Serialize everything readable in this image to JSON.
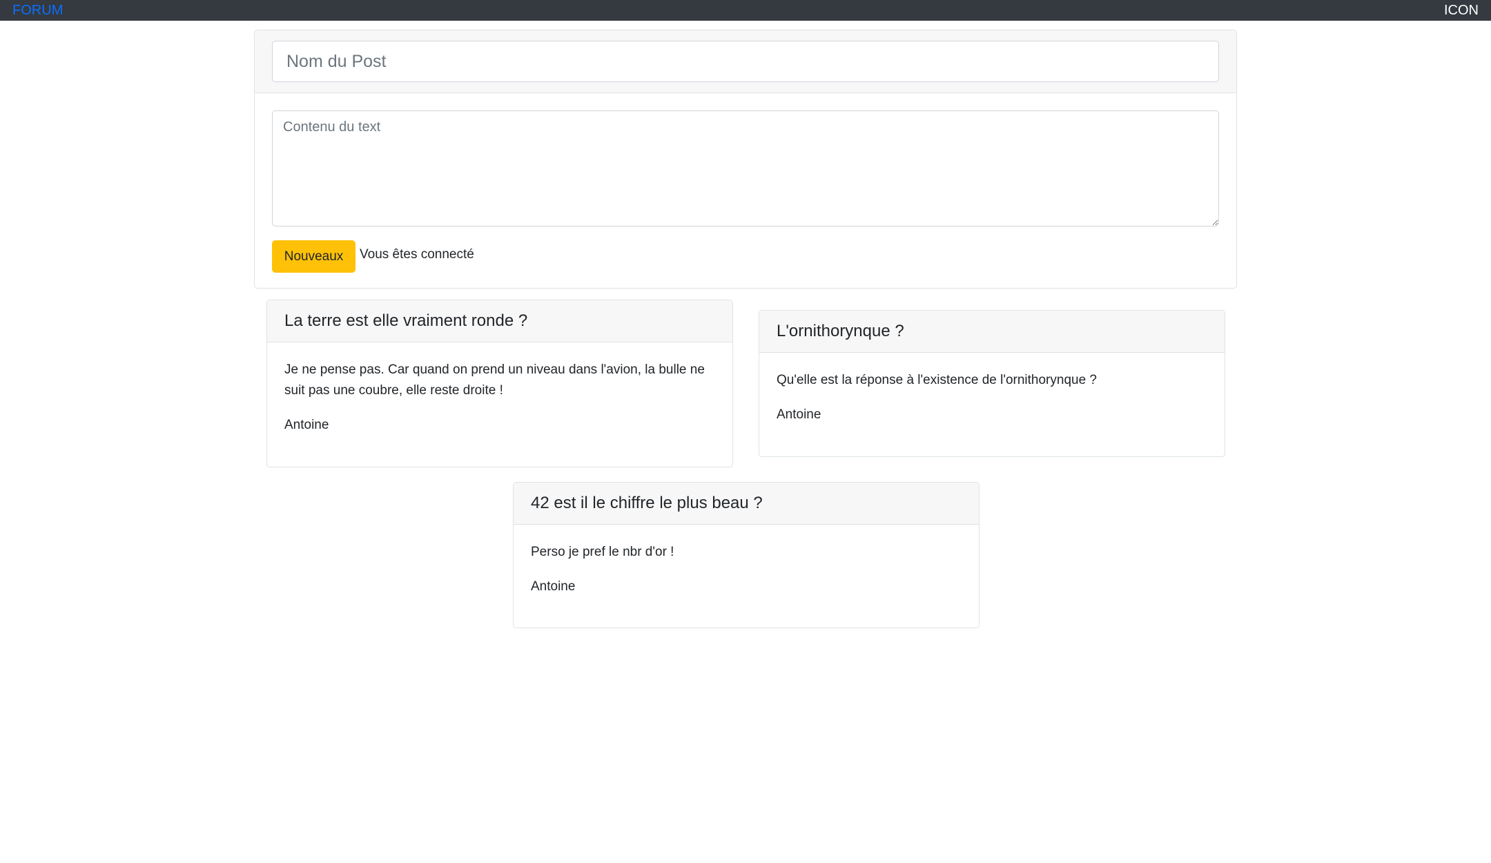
{
  "nav": {
    "brand": "FORUM",
    "icon_label": "ICON"
  },
  "new_post": {
    "title_placeholder": "Nom du Post",
    "content_placeholder": "Contenu du text",
    "button_label": "Nouveaux",
    "status": "Vous êtes connecté"
  },
  "posts": [
    {
      "title": "La terre est elle vraiment ronde ?",
      "text": "Je ne pense pas. Car quand on prend un niveau dans l'avion, la bulle ne suit pas une coubre, elle reste droite !",
      "author": "Antoine"
    },
    {
      "title": "L'ornithorynque ?",
      "text": "Qu'elle est la réponse à l'existence de l'ornithorynque ?",
      "author": "Antoine"
    },
    {
      "title": "42 est il le chiffre le plus beau ?",
      "text": "Perso je pref le nbr d'or !",
      "author": "Antoine"
    }
  ],
  "colors": {
    "navbar": "#343a40",
    "brand": "#0d6efd",
    "button": "#ffc107"
  }
}
